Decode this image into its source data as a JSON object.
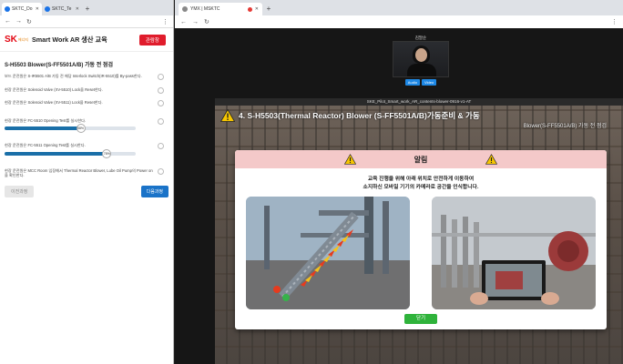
{
  "left_browser": {
    "tabs": [
      {
        "label": "SKTC_Do"
      },
      {
        "label": "SKTC_Te"
      }
    ],
    "app": {
      "logo_main": "SK",
      "logo_sub": "에너지",
      "title": "Smart Work AR 생산 교육",
      "exit_label": "관람창"
    },
    "section_title": "S-H5503 Blower(S-FF5501A/B) 가동 전 점검",
    "checklist": [
      {
        "text": "보드 운전원은 S-IR5501 A/B 가동 전 해당 Interlock Switch(IR-5510)를 By-pass한다."
      },
      {
        "text": "현장 운전원은 Solenoid Valve (XV-5510) Lock을 Reset한다."
      },
      {
        "text": "현장 운전원은 Solenoid Valve (XV-5511) Lock을 Reset한다."
      },
      {
        "text": "현장 운전원은 FC-5510 Opening Test를 실시한다.",
        "slider_percent": 58,
        "slider_label": "58%"
      },
      {
        "text": "현장 운전원은 FC-5511 Opening Test를 실시한다.",
        "slider_percent": 78,
        "slider_label": "78%"
      },
      {
        "text": "현장 운전원은 MCC Room 입장해서 Thermal Reactor Blower, Lube Oil Pump의 Power on을 확인한다."
      }
    ],
    "prev_label": "이전과정",
    "next_label": "다음과정"
  },
  "right_browser": {
    "tab_label": "YMX | MSKTC",
    "participant": {
      "name": "김말순",
      "audio_label": "Audio",
      "video_label": "Video"
    },
    "ar_window_title": "SKE_Pilot_Smart_work_AR_contents-blower-0916-v1-AT",
    "ar_header": "4. S-H5503(Thermal Reactor) Blower (S-FF5501A/B)가동준비 & 가동",
    "ar_side": "Blower(S-FF5501A/B) 가동 전 점검",
    "modal": {
      "title": "알림",
      "line1": "교육 진행을 위해 아래 위치로 안전하게 이동하여",
      "line2": "소지하신 모바일 기기의 카메라로 공간을 인식합니다.",
      "close_label": "닫기"
    }
  },
  "colors": {
    "brand_red": "#e30613",
    "primary_blue": "#1a73c8",
    "slider_blue": "#1a6fa8",
    "modal_header": "#f4c9c9",
    "close_green": "#2fb33b"
  }
}
